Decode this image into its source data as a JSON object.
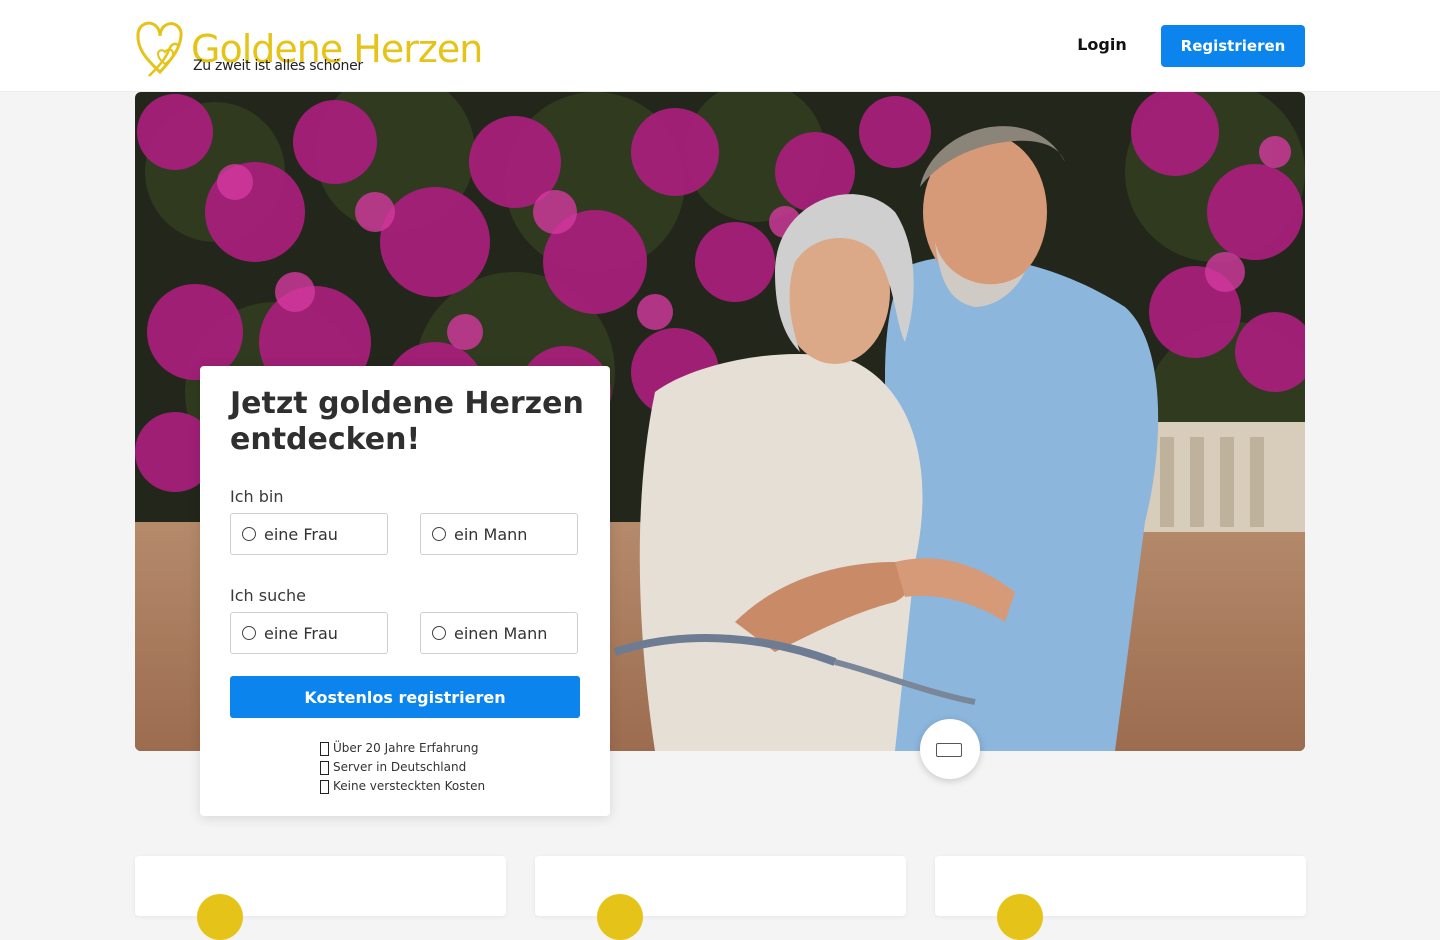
{
  "brand": {
    "name": "Goldene Herzen",
    "tagline": "Zu zweit ist alles schöner",
    "gold_color": "#e6c318",
    "accent_color": "#0b84ee"
  },
  "header": {
    "login_label": "Login",
    "register_label": "Registrieren"
  },
  "hero": {
    "image_icon": "photo-couple-icon"
  },
  "signup": {
    "title": "Jetzt goldene Herzen entdecken!",
    "i_am": {
      "label": "Ich bin",
      "options": [
        "eine Frau",
        "ein Mann"
      ]
    },
    "seeking": {
      "label": "Ich suche",
      "options": [
        "eine Frau",
        "einen Mann"
      ]
    },
    "cta_label": "Kostenlos registrieren",
    "features": [
      "Über 20 Jahre Erfahrung",
      "Server in Deutschland",
      "Keine versteckten Kosten"
    ]
  },
  "chat": {
    "icon": "chat-icon"
  }
}
